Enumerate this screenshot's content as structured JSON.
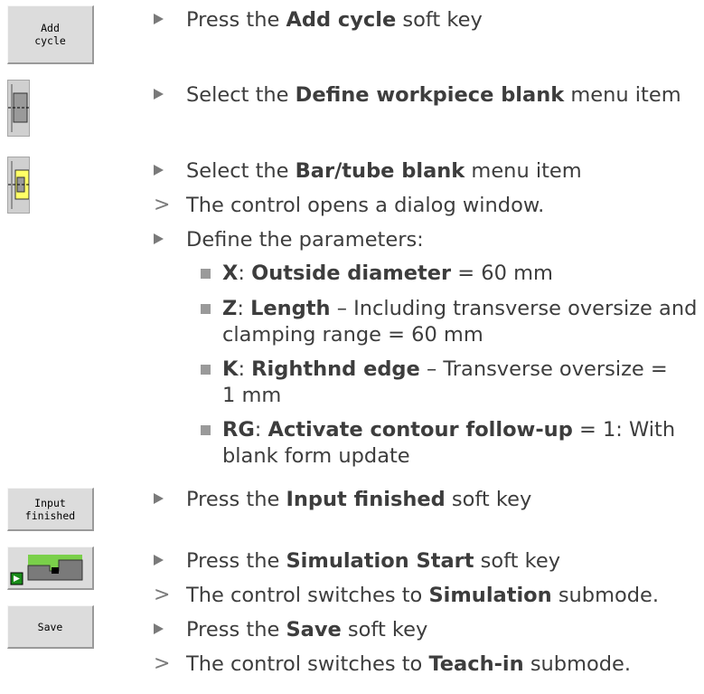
{
  "softkeys": {
    "add_cycle": "Add\ncycle",
    "input_finished": "Input\nfinished",
    "save": "Save"
  },
  "icons": {
    "workpiece_blank": "define-workpiece-blank-icon",
    "bar_tube_blank": "bar-tube-blank-icon",
    "simulation_start": "simulation-start-icon"
  },
  "steps": {
    "s1": {
      "pre": "Press the ",
      "bold": "Add cycle",
      "post": " soft key"
    },
    "s2": {
      "pre": "Select the ",
      "bold": "Define workpiece blank",
      "post": " menu item"
    },
    "s3": {
      "pre": "Select the ",
      "bold": "Bar/tube blank",
      "post": " menu item"
    },
    "r1": {
      "text": "The control opens a dialog window."
    },
    "s4": {
      "text": "Define the parameters:"
    },
    "s5": {
      "pre": "Press the ",
      "bold": "Input finished",
      "post": " soft key"
    },
    "s6": {
      "pre": "Press the ",
      "bold": "Simulation Start",
      "post": " soft key"
    },
    "r2": {
      "pre": "The control switches to ",
      "bold": "Simulation",
      "post": " submode."
    },
    "s7": {
      "pre": "Press the ",
      "bold": "Save",
      "post": " soft key"
    },
    "r3": {
      "pre": "The control switches to ",
      "bold": "Teach-in",
      "post": " submode."
    }
  },
  "params": {
    "p1": {
      "key": "X",
      "sep": ": ",
      "name": "Outside diameter",
      "line1": " = 60 mm",
      "line2": ""
    },
    "p2": {
      "key": "Z",
      "sep": ": ",
      "name": "Length",
      "line1": " – Including transverse oversize and",
      "line2": "clamping range = 60 mm"
    },
    "p3": {
      "key": "K",
      "sep": ": ",
      "name": "Righthnd edge",
      "line1": " – Transverse oversize =",
      "line2": "1 mm"
    },
    "p4": {
      "key": "RG",
      "sep": ": ",
      "name": "Activate contour follow-up",
      "line1": " = 1: With",
      "line2": "blank form update"
    }
  },
  "colors": {
    "text": "#3d3d3d",
    "marker": "#7a7a7a",
    "key_face": "#dcdcdc",
    "sim_green": "#7ad04a",
    "blank_yellow": "#ffff66"
  }
}
